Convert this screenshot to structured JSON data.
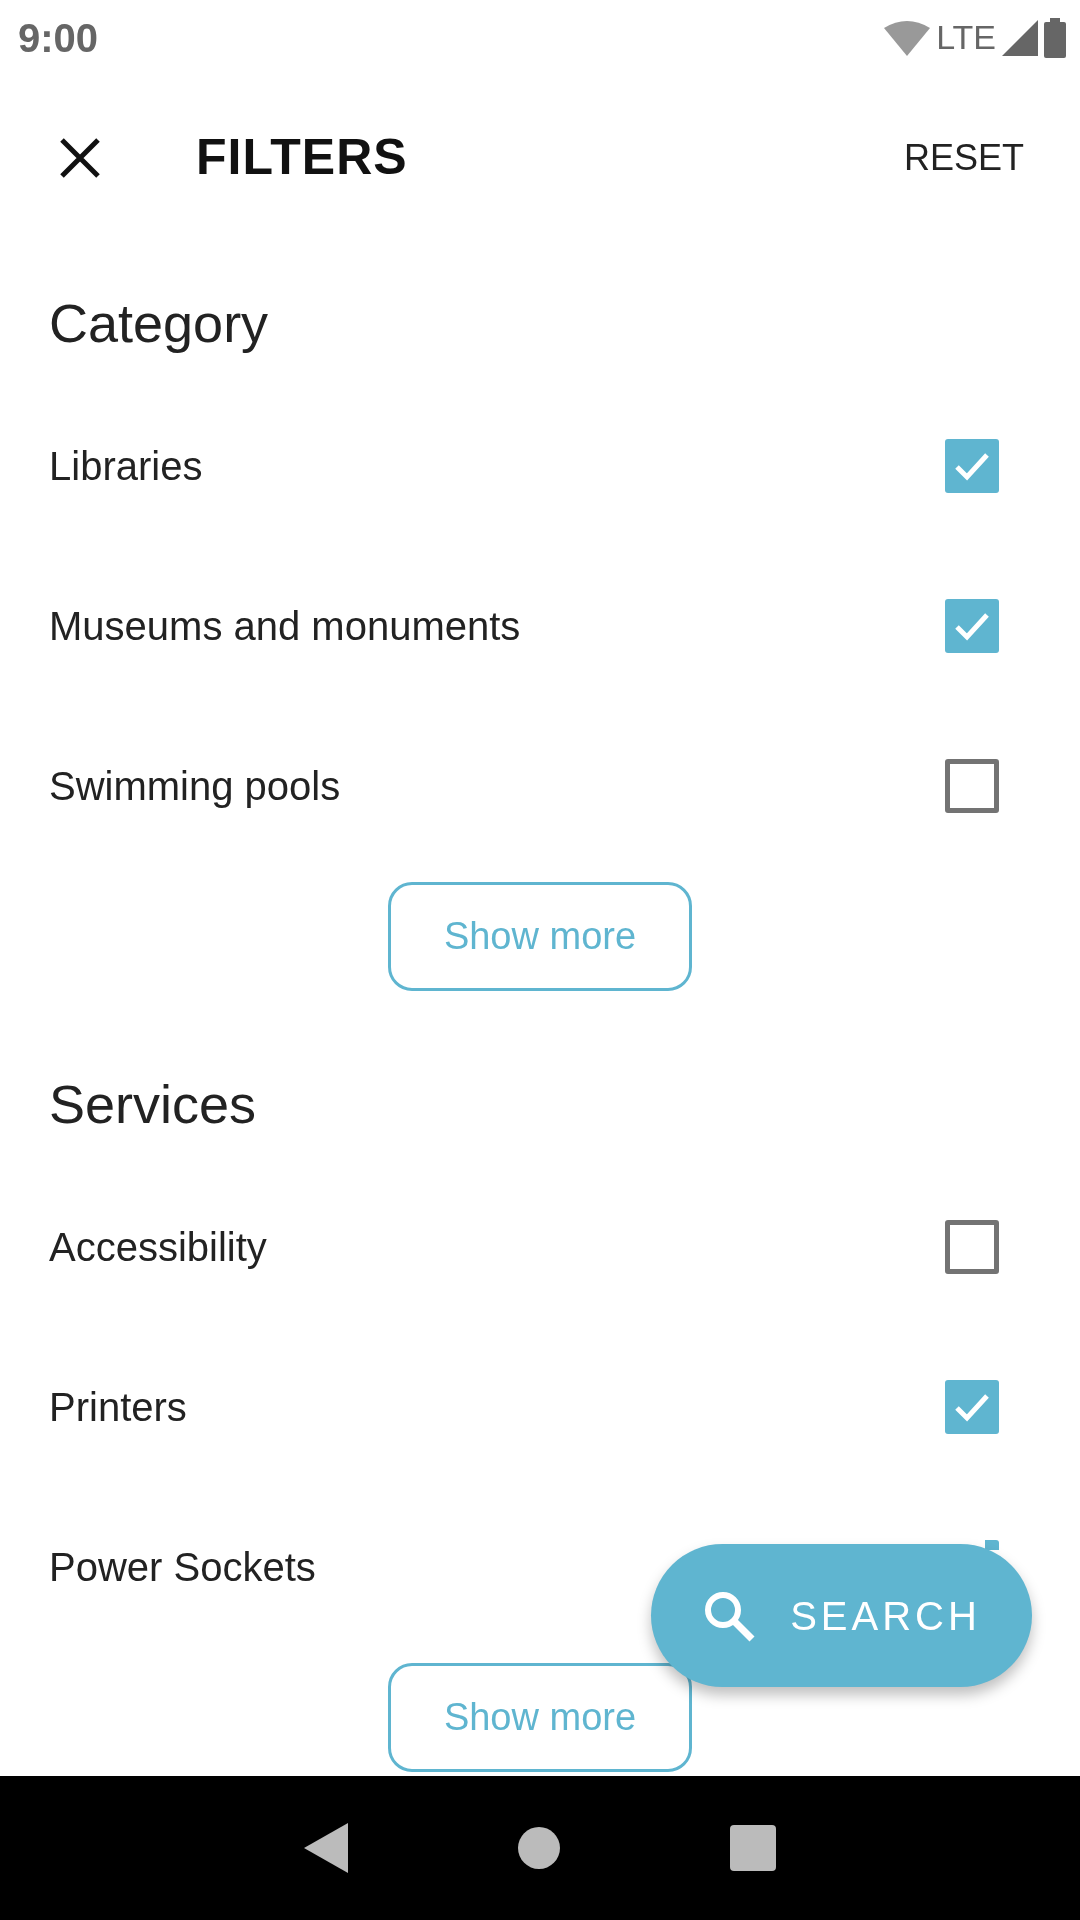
{
  "status_bar": {
    "time": "9:00",
    "network": "LTE"
  },
  "toolbar": {
    "title": "FILTERS",
    "action": "RESET"
  },
  "sections": [
    {
      "heading": "Category",
      "items": [
        {
          "label": "Libraries",
          "checked": true
        },
        {
          "label": "Museums and monuments",
          "checked": true
        },
        {
          "label": "Swimming pools",
          "checked": false
        }
      ],
      "more_button": "Show more"
    },
    {
      "heading": "Services",
      "items": [
        {
          "label": "Accessibility",
          "checked": false
        },
        {
          "label": "Printers",
          "checked": true
        },
        {
          "label": "Power Sockets",
          "checked": true
        }
      ],
      "more_button": "Show more"
    }
  ],
  "search_button": {
    "label": "SEARCH"
  }
}
